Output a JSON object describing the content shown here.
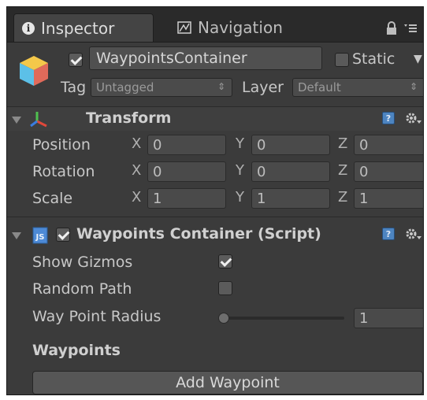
{
  "tabs": {
    "inspector": "Inspector",
    "navigation": "Navigation"
  },
  "game_object": {
    "active": true,
    "name": "WaypointsContainer",
    "static_label": "Static",
    "static": false,
    "tag_label": "Tag",
    "tag_value": "Untagged",
    "layer_label": "Layer",
    "layer_value": "Default"
  },
  "transform": {
    "title": "Transform",
    "rows": [
      {
        "label": "Position",
        "x": "0",
        "y": "0",
        "z": "0"
      },
      {
        "label": "Rotation",
        "x": "0",
        "y": "0",
        "z": "0"
      },
      {
        "label": "Scale",
        "x": "1",
        "y": "1",
        "z": "1"
      }
    ],
    "axes": {
      "x": "X",
      "y": "Y",
      "z": "Z"
    }
  },
  "script_component": {
    "title": "Waypoints Container (Script)",
    "enabled": true,
    "show_gizmos_label": "Show Gizmos",
    "show_gizmos": true,
    "random_path_label": "Random Path",
    "random_path": false,
    "radius_label": "Way Point Radius",
    "radius_value": "1",
    "radius_slider_fraction": 0.0,
    "waypoints_label": "Waypoints",
    "add_button": "Add Waypoint"
  },
  "colors": {
    "panel": "#3b3b3b",
    "text": "#c8c8c8",
    "help_icon": "#4d84c0"
  }
}
